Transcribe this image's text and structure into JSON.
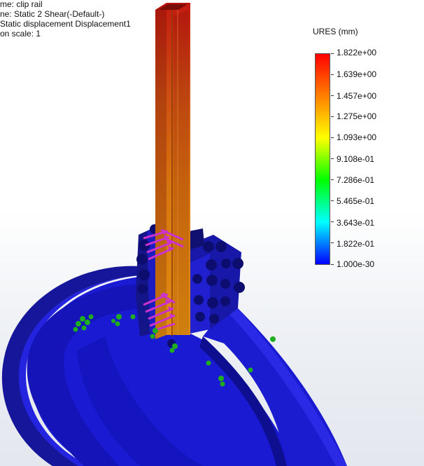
{
  "header": {
    "lines": [
      "me: clip rail",
      "ne: Static 2 Shear(-Default-)",
      "Static displacement Displacement1",
      "on scale: 1"
    ]
  },
  "legend": {
    "title": "URES (mm)",
    "ticks": [
      "1.822e+00",
      "1.639e+00",
      "1.457e+00",
      "1.275e+00",
      "1.093e+00",
      "9.108e-01",
      "7.286e-01",
      "5.465e-01",
      "3.643e-01",
      "1.822e-01",
      "1.000e-30"
    ],
    "colors": [
      "#ff0000",
      "#ff8000",
      "#ffff00",
      "#00ff00",
      "#00ffff",
      "#0000ff"
    ]
  },
  "model": {
    "ring_color": "#1a1ad2",
    "rail_top_color": "#d22a12",
    "rail_bottom_color": "#e0860e",
    "fixture_color": "#1fae1f",
    "load_arrow_color": "#cc33cc"
  }
}
